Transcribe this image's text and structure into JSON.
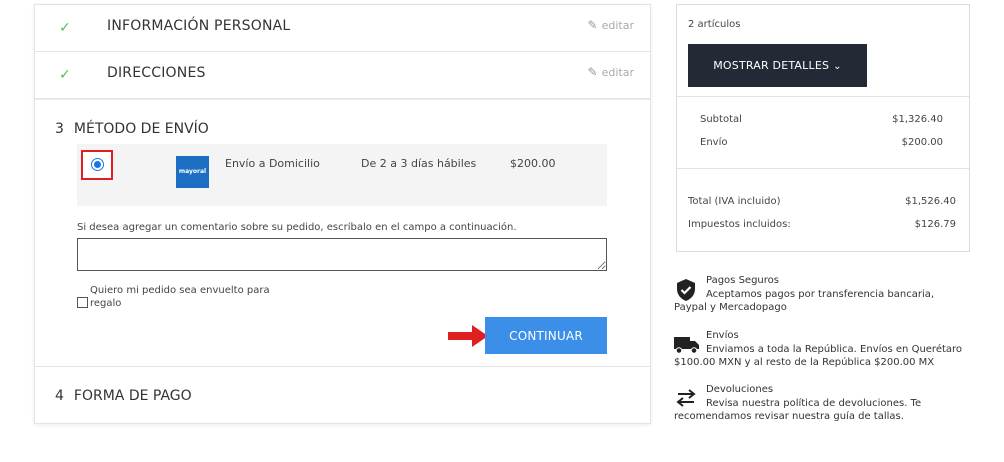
{
  "checkout": {
    "step1": {
      "check": "✓",
      "title": "INFORMACIÓN PERSONAL",
      "edit": "editar"
    },
    "step2": {
      "check": "✓",
      "title": "DIRECCIONES",
      "edit": "editar"
    },
    "step3": {
      "number": "3",
      "title": "MÉTODO DE ENVÍO",
      "shipping_option": {
        "logo": "mayoral",
        "name": "Envío a Domicilio",
        "time": "De 2 a 3 días hábiles",
        "price": "$200.00"
      },
      "comment_label": "Si desea agregar un comentario sobre su pedido, escríbalo en el campo a continuación.",
      "comment_value": "",
      "gift_label_line1": "Quiero mi pedido sea envuelto para",
      "gift_label_line2": "regalo",
      "continue_label": "CONTINUAR"
    },
    "step4": {
      "number": "4",
      "title": "FORMA DE PAGO"
    }
  },
  "summary": {
    "items_count": "2 artículos",
    "details_button": "MOSTRAR DETALLES",
    "subtotal_label": "Subtotal",
    "subtotal_value": "$1,326.40",
    "shipping_label": "Envío",
    "shipping_value": "$200.00",
    "total_label": "Total (IVA incluido)",
    "total_value": "$1,526.40",
    "taxes_label": "Impuestos incluidos:",
    "taxes_value": "$126.79"
  },
  "info": {
    "secure": {
      "title": "Pagos Seguros",
      "line1": "Aceptamos pagos por transferencia bancaria,",
      "line2": "Paypal y Mercadopago"
    },
    "shipping": {
      "title": "Envíos",
      "line1": "Enviamos a toda la República. Envíos en Querétaro",
      "line2": "$100.00 MXN y al resto de la República $200.00 MX"
    },
    "returns": {
      "title": "Devoluciones",
      "line1": "Revisa nuestra política de devoluciones. Te",
      "line2": "recomendamos revisar nuestra guía de tallas."
    }
  },
  "colors": {
    "accent": "#3b8fe8",
    "dark_button": "#232a35",
    "check": "#5cb85c",
    "highlight": "#e02020"
  }
}
